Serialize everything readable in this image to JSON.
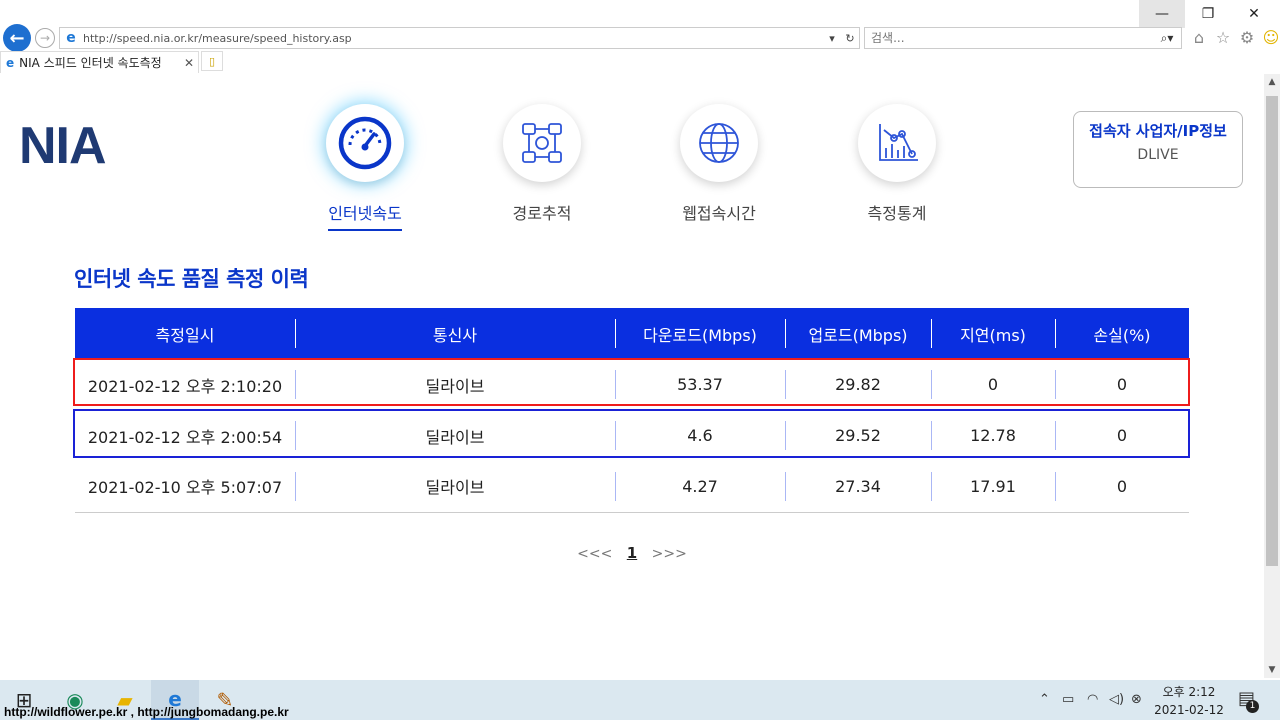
{
  "browser": {
    "url": "http://speed.nia.or.kr/measure/speed_history.asp",
    "search_placeholder": "검색...",
    "tab_title": "NIA 스피드 인터넷 속도측정",
    "window_controls": {
      "minimize_icon": "—",
      "restore_icon": "❐",
      "close_icon": "✕"
    },
    "tool_icons": [
      "home-icon",
      "favorites-star-icon",
      "settings-gear-icon",
      "feedback-smiley-icon"
    ]
  },
  "site": {
    "logo": "NIA",
    "menu": [
      {
        "label": "인터넷속도",
        "icon": "speedometer-icon",
        "active": true
      },
      {
        "label": "경로추적",
        "icon": "route-trace-icon",
        "active": false
      },
      {
        "label": "웹접속시간",
        "icon": "globe-icon",
        "active": false
      },
      {
        "label": "측정통계",
        "icon": "statistics-chart-icon",
        "active": false
      }
    ],
    "ip_info": {
      "title": "접속자 사업자/IP정보",
      "value": "DLIVE"
    }
  },
  "history": {
    "title": "인터넷 속도 품질 측정 이력",
    "columns": [
      "측정일시",
      "통신사",
      "다운로드(Mbps)",
      "업로드(Mbps)",
      "지연(ms)",
      "손실(%)"
    ],
    "rows": [
      [
        "2021-02-12 오후 2:10:20",
        "딜라이브",
        "53.37",
        "29.82",
        "0",
        "0"
      ],
      [
        "2021-02-12 오후 2:00:54",
        "딜라이브",
        "4.6",
        "29.52",
        "12.78",
        "0"
      ],
      [
        "2021-02-10 오후 5:07:07",
        "딜라이브",
        "4.27",
        "27.34",
        "17.91",
        "0"
      ]
    ],
    "highlight_colors": {
      "first_row": "#ee1c1c",
      "second_row": "#1a22d6"
    }
  },
  "pager": {
    "prev": "<<<",
    "current": "1",
    "next": ">>>"
  },
  "colors": {
    "accent": "#0a36c9",
    "header_bg": "#0a2fe0",
    "logo": "#1f3a73"
  },
  "taskbar": {
    "apps": [
      "windows-start-icon",
      "edge-icon",
      "file-explorer-icon",
      "internet-explorer-icon",
      "paint-icon"
    ],
    "watermark": "http://wildflower.pe.kr , http://jungbomadang.pe.kr",
    "clock_time": "오후 2:12",
    "clock_date": "2021-02-12",
    "notification_count": "1"
  }
}
